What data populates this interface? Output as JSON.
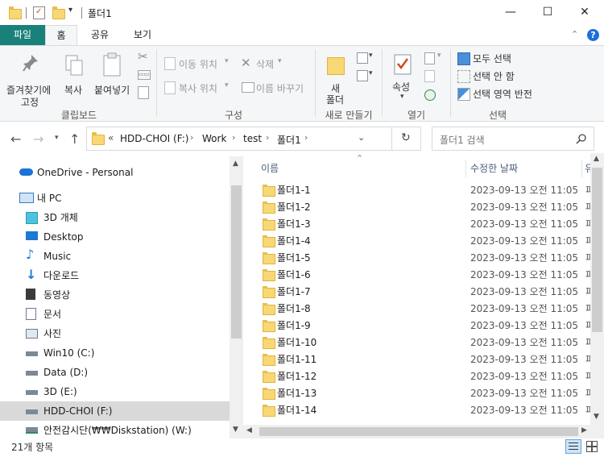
{
  "window": {
    "title": "폴더1",
    "minimize": "—",
    "maximize": "☐",
    "close": "✕"
  },
  "tabs": {
    "file": "파일",
    "home": "홈",
    "share": "공유",
    "view": "보기"
  },
  "ribbon": {
    "pin_label_1": "즐겨찾기에",
    "pin_label_2": "고정",
    "copy": "복사",
    "paste": "붙여넣기",
    "move_to": "이동 위치",
    "copy_to": "복사 위치",
    "delete": "삭제",
    "rename": "이름 바꾸기",
    "new_folder_1": "새",
    "new_folder_2": "폴더",
    "properties": "속성",
    "select_all": "모두 선택",
    "select_none": "선택 안 함",
    "invert_selection": "선택 영역 반전",
    "group_clipboard": "클립보드",
    "group_organize": "구성",
    "group_new": "새로 만들기",
    "group_open": "열기",
    "group_select": "선택"
  },
  "address": {
    "prefix": "«",
    "crumbs": [
      "HDD-CHOI (F:)",
      "Work",
      "test",
      "폴더1"
    ],
    "search_placeholder": "폴더1 검색"
  },
  "nav": {
    "items": [
      {
        "label": "OneDrive - Personal",
        "icon": "onedrive-icon"
      },
      {
        "label": "내 PC",
        "icon": "pc-icon"
      },
      {
        "label": "3D 개체",
        "icon": "3d-objects-icon"
      },
      {
        "label": "Desktop",
        "icon": "desktop-icon"
      },
      {
        "label": "Music",
        "icon": "music-icon"
      },
      {
        "label": "다운로드",
        "icon": "downloads-icon"
      },
      {
        "label": "동영상",
        "icon": "videos-icon"
      },
      {
        "label": "문서",
        "icon": "documents-icon"
      },
      {
        "label": "사진",
        "icon": "pictures-icon"
      },
      {
        "label": "Win10 (C:)",
        "icon": "drive-icon"
      },
      {
        "label": "Data (D:)",
        "icon": "drive-icon"
      },
      {
        "label": "3D (E:)",
        "icon": "drive-icon"
      },
      {
        "label": "HDD-CHOI (F:)",
        "icon": "drive-icon"
      },
      {
        "label": "안전감시단(₩₩Diskstation) (W:)",
        "icon": "network-drive-icon"
      }
    ]
  },
  "list": {
    "col_name": "이름",
    "col_date": "수정한 날짜",
    "col_type": "유",
    "rows": [
      {
        "name": "폴더1-1",
        "date": "2023-09-13 오전 11:05",
        "type": "파"
      },
      {
        "name": "폴더1-2",
        "date": "2023-09-13 오전 11:05",
        "type": "파"
      },
      {
        "name": "폴더1-3",
        "date": "2023-09-13 오전 11:05",
        "type": "파"
      },
      {
        "name": "폴더1-4",
        "date": "2023-09-13 오전 11:05",
        "type": "파"
      },
      {
        "name": "폴더1-5",
        "date": "2023-09-13 오전 11:05",
        "type": "파"
      },
      {
        "name": "폴더1-6",
        "date": "2023-09-13 오전 11:05",
        "type": "파"
      },
      {
        "name": "폴더1-7",
        "date": "2023-09-13 오전 11:05",
        "type": "파"
      },
      {
        "name": "폴더1-8",
        "date": "2023-09-13 오전 11:05",
        "type": "파"
      },
      {
        "name": "폴더1-9",
        "date": "2023-09-13 오전 11:05",
        "type": "파"
      },
      {
        "name": "폴더1-10",
        "date": "2023-09-13 오전 11:05",
        "type": "파"
      },
      {
        "name": "폴더1-11",
        "date": "2023-09-13 오전 11:05",
        "type": "파"
      },
      {
        "name": "폴더1-12",
        "date": "2023-09-13 오전 11:05",
        "type": "파"
      },
      {
        "name": "폴더1-13",
        "date": "2023-09-13 오전 11:05",
        "type": "파"
      },
      {
        "name": "폴더1-14",
        "date": "2023-09-13 오전 11:05",
        "type": "파"
      }
    ]
  },
  "status": {
    "count": "21개 항목"
  },
  "colors": {
    "file_tab": "#19807a",
    "selected_nav": "#d9d9d9",
    "folder": "#f8d775"
  }
}
